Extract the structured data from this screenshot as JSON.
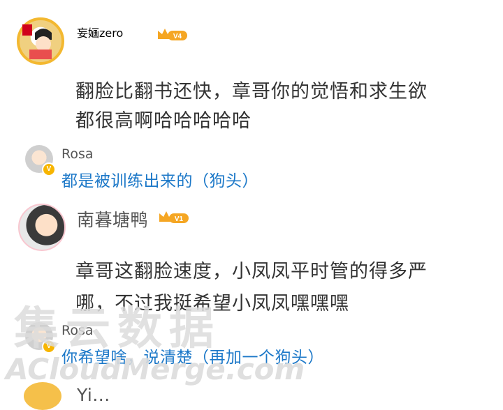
{
  "comments": [
    {
      "username": "妄婳zero",
      "level": "V4",
      "text_line1": "翻脸比翻书还快，章哥你的觉悟和求生欲",
      "text_line2": "都很高啊哈哈哈哈哈",
      "reply": {
        "username": "Rosa",
        "text": "都是被训练出来的（狗头）"
      }
    },
    {
      "username": "南暮塘鸭",
      "level": "V1",
      "text_line1": "章哥这翻脸速度，小凤凤平时管的得多严",
      "text_line2": "哪，不过我挺希望小凤凤嘿嘿嘿",
      "reply": {
        "username": "Rosa",
        "text": "你希望啥，说清楚（再加一个狗头）"
      }
    }
  ],
  "partial_next_username": "Yi...",
  "watermark": {
    "cn": "集云数据",
    "en": "ACloudMerge.com"
  },
  "colors": {
    "reply_blue": "#1c78c8",
    "crown_gold": "#f5a623",
    "badge_orange": "#f7b500"
  }
}
